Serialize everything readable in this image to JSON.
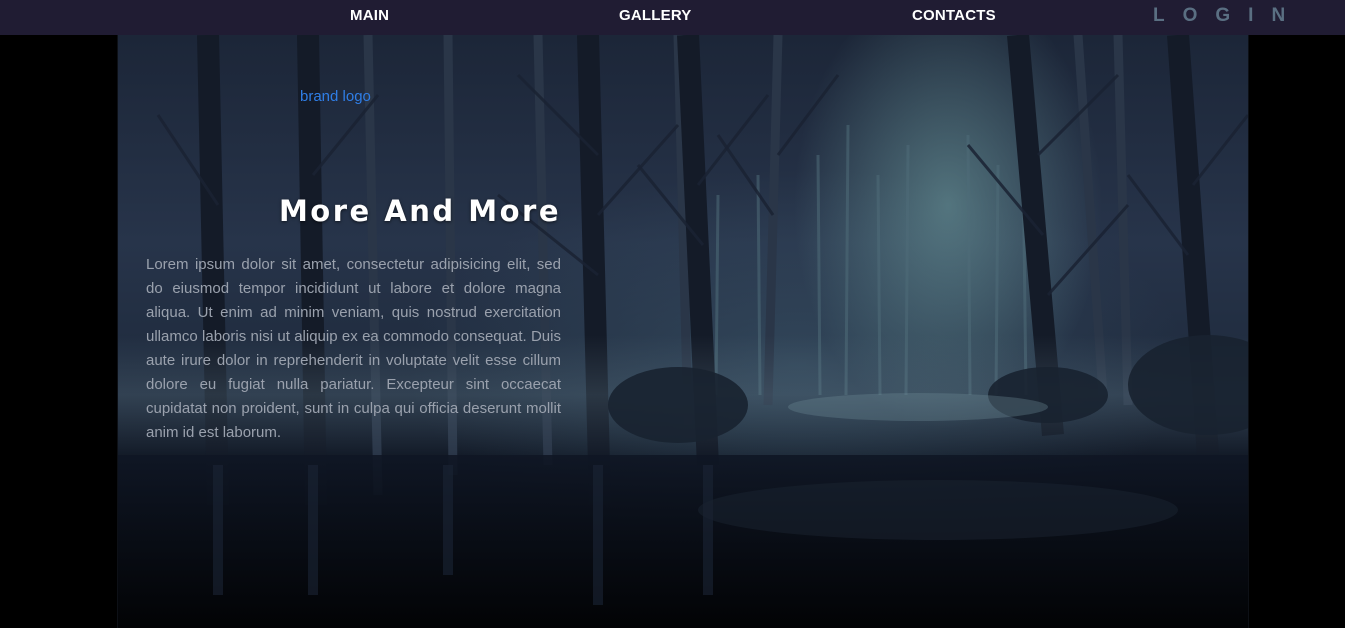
{
  "nav": {
    "items": [
      {
        "label": "MAIN"
      },
      {
        "label": "GALLERY"
      },
      {
        "label": "CONTACTS"
      }
    ],
    "login": "LOGIN"
  },
  "hero": {
    "brand_logo": "brand logo",
    "title": "More And More",
    "body": "Lorem ipsum dolor sit amet, consectetur adipisicing elit, sed do eiusmod tempor incididunt ut labore et dolore magna aliqua. Ut enim ad minim veniam, quis nostrud exercitation ullamco laboris nisi ut aliquip ex ea commodo consequat. Duis aute irure dolor in reprehenderit in voluptate velit esse cillum dolore eu fugiat nulla pariatur. Excepteur sint occaecat cupidatat non proident, sunt in culpa qui officia deserunt mollit anim id est laborum."
  },
  "colors": {
    "navbar_bg": "#201c33",
    "nav_text": "#ffffff",
    "login_text": "#5a6f82",
    "brand_logo": "#2f7ee6",
    "page_bg": "#000000"
  }
}
